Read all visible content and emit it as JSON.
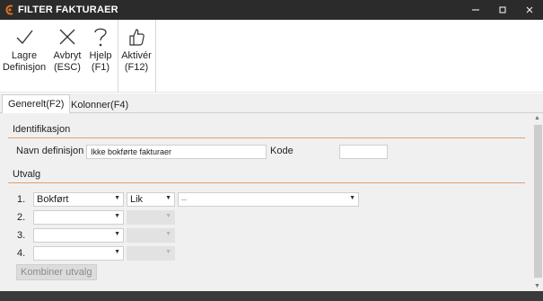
{
  "window": {
    "title": "FILTER  FAKTURAER",
    "logo_color": "#e07020"
  },
  "toolbar": {
    "save": {
      "icon": "checkmark-icon",
      "label": "Lagre\nDefinisjon"
    },
    "cancel": {
      "icon": "close-x-icon",
      "label": "Avbryt\n(ESC)"
    },
    "help": {
      "icon": "question-icon",
      "label": "Hjelp\n(F1)"
    },
    "activate": {
      "icon": "thumbs-up-icon",
      "label": "Aktivér\n(F12)"
    }
  },
  "tabs": [
    {
      "label": "Generelt(F2)",
      "active": true
    },
    {
      "label": "Kolonner(F4)",
      "active": false
    }
  ],
  "identification": {
    "header": "Identifikasjon",
    "name_label": "Navn definisjon",
    "name_value": "Ikke bokførte fakturaer",
    "code_label": "Kode",
    "code_value": ""
  },
  "selection": {
    "header": "Utvalg",
    "rows": [
      {
        "num": "1.",
        "field": "Bokført",
        "operator": "Lik",
        "value": "--"
      },
      {
        "num": "2.",
        "field": "",
        "operator": "",
        "value": ""
      },
      {
        "num": "3.",
        "field": "",
        "operator": "",
        "value": ""
      },
      {
        "num": "4.",
        "field": "",
        "operator": "",
        "value": ""
      }
    ],
    "combine_label": "Kombiner utvalg"
  },
  "colors": {
    "accent": "#e0a070",
    "titlebar": "#2b2b2b"
  }
}
